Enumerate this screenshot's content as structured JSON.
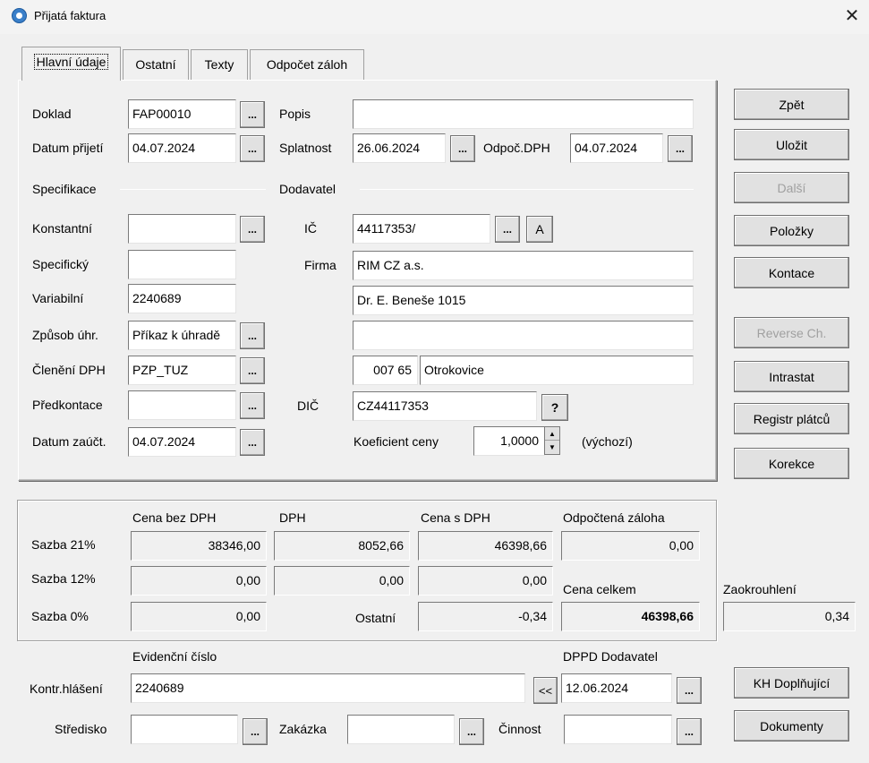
{
  "window": {
    "title": "Přijatá faktura",
    "close": "✕"
  },
  "tabs": [
    {
      "label": "Hlavní údaje",
      "active": true
    },
    {
      "label": "Ostatní"
    },
    {
      "label": "Texty"
    },
    {
      "label": "Odpočet záloh"
    }
  ],
  "main": {
    "doklad_label": "Doklad",
    "doklad": "FAP00010",
    "datum_prijeti_label": "Datum přijetí",
    "datum_prijeti": "04.07.2024",
    "popis_label": "Popis",
    "popis": "",
    "splatnost_label": "Splatnost",
    "splatnost": "26.06.2024",
    "odpoc_dph_label": "Odpoč.DPH",
    "odpoc_dph": "04.07.2024",
    "specifikace_label": "Specifikace",
    "dodavatel_label": "Dodavatel",
    "konstantni_label": "Konstantní",
    "konstantni": "",
    "specificky_label": "Specifický",
    "specificky": "",
    "variabilni_label": "Variabilní",
    "variabilni": "2240689",
    "zpusob_label": "Způsob úhr.",
    "zpusob": "Příkaz k úhradě",
    "cleneni_label": "Členění DPH",
    "cleneni": "PZP_TUZ",
    "predkontace_label": "Předkontace",
    "predkontace": "",
    "datum_zauct_label": "Datum zaúčt.",
    "datum_zauct": "04.07.2024",
    "ic_label": "IČ",
    "ic": "44117353/",
    "ares_btn": "A",
    "firma_label": "Firma",
    "firma": "RIM CZ a.s.",
    "ulice": "Dr. E. Beneše 1015",
    "adresa2": "",
    "psc": "007 65",
    "mesto": "Otrokovice",
    "dic_label": "DIČ",
    "dic": "CZ44117353",
    "dic_btn": "?",
    "koef_label": "Koeficient ceny",
    "koef": "1,0000",
    "vychozi": "(výchozí)",
    "dots": "..."
  },
  "buttons": [
    "Zpět",
    "Uložit",
    "Další",
    "Položky",
    "Kontace",
    "Reverse Ch.",
    "Intrastat",
    "Registr plátců",
    "Korekce"
  ],
  "totals": {
    "h_bez": "Cena bez DPH",
    "h_dph": "DPH",
    "h_s": "Cena s DPH",
    "h_zaloha": "Odpočtená záloha",
    "r21": "Sazba 21%",
    "r12": "Sazba 12%",
    "r0": "Sazba 0%",
    "bez21": "38346,00",
    "dph21": "8052,66",
    "s21": "46398,66",
    "zaloha": "0,00",
    "bez12": "0,00",
    "dph12": "0,00",
    "s12": "0,00",
    "cena_celkem_label": "Cena celkem",
    "bez0": "0,00",
    "ostatni_label": "Ostatní",
    "ostatni": "-0,34",
    "cena_celkem": "46398,66",
    "zaokr_label": "Zaokrouhlení",
    "zaokr": "0,34"
  },
  "bottom": {
    "evid_label": "Evidenční číslo",
    "kontr_label": "Kontr.hlášení",
    "kontr": "2240689",
    "copy_btn": "<<",
    "dppd_label": "DPPD Dodavatel",
    "dppd": "12.06.2024",
    "stredisko_label": "Středisko",
    "zakazka_label": "Zakázka",
    "cinnost_label": "Činnost",
    "kh_btn": "KH Doplňující",
    "dokumenty_btn": "Dokumenty"
  }
}
